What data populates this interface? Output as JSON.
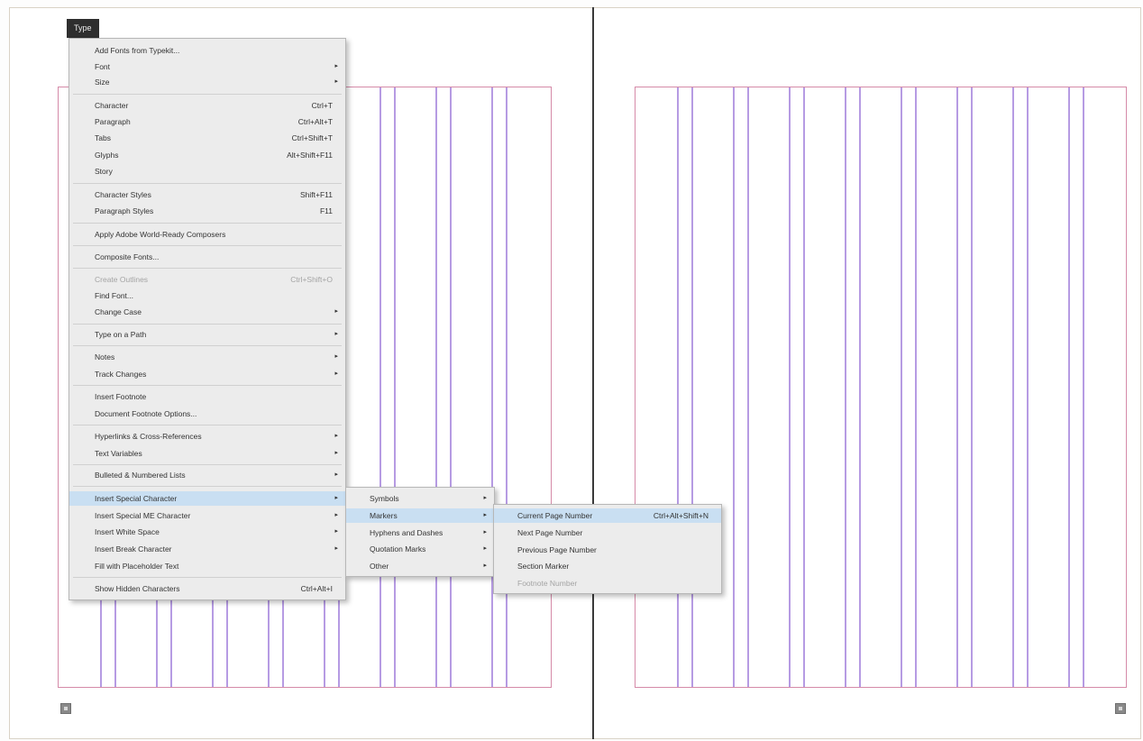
{
  "menu_bar": {
    "tab_label": "Type"
  },
  "type_menu": {
    "items": [
      {
        "label": "Add Fonts from Typekit...",
        "shortcut": "",
        "submenu": false
      },
      {
        "label": "Font",
        "shortcut": "",
        "submenu": true
      },
      {
        "label": "Size",
        "shortcut": "",
        "submenu": true
      },
      {
        "label": "Character",
        "shortcut": "Ctrl+T",
        "submenu": false
      },
      {
        "label": "Paragraph",
        "shortcut": "Ctrl+Alt+T",
        "submenu": false
      },
      {
        "label": "Tabs",
        "shortcut": "Ctrl+Shift+T",
        "submenu": false
      },
      {
        "label": "Glyphs",
        "shortcut": "Alt+Shift+F11",
        "submenu": false
      },
      {
        "label": "Story",
        "shortcut": "",
        "submenu": false
      },
      {
        "label": "Character Styles",
        "shortcut": "Shift+F11",
        "submenu": false
      },
      {
        "label": "Paragraph Styles",
        "shortcut": "F11",
        "submenu": false
      },
      {
        "label": "Apply Adobe World-Ready Composers",
        "shortcut": "",
        "submenu": false
      },
      {
        "label": "Composite Fonts...",
        "shortcut": "",
        "submenu": false
      },
      {
        "label": "Create Outlines",
        "shortcut": "Ctrl+Shift+O",
        "submenu": false,
        "disabled": true
      },
      {
        "label": "Find Font...",
        "shortcut": "",
        "submenu": false
      },
      {
        "label": "Change Case",
        "shortcut": "",
        "submenu": true
      },
      {
        "label": "Type on a Path",
        "shortcut": "",
        "submenu": true
      },
      {
        "label": "Notes",
        "shortcut": "",
        "submenu": true
      },
      {
        "label": "Track Changes",
        "shortcut": "",
        "submenu": true
      },
      {
        "label": "Insert Footnote",
        "shortcut": "",
        "submenu": false
      },
      {
        "label": "Document Footnote Options...",
        "shortcut": "",
        "submenu": false
      },
      {
        "label": "Hyperlinks & Cross-References",
        "shortcut": "",
        "submenu": true
      },
      {
        "label": "Text Variables",
        "shortcut": "",
        "submenu": true
      },
      {
        "label": "Bulleted & Numbered Lists",
        "shortcut": "",
        "submenu": true
      },
      {
        "label": "Insert Special Character",
        "shortcut": "",
        "submenu": true,
        "highlighted": true
      },
      {
        "label": "Insert Special ME Character",
        "shortcut": "",
        "submenu": true
      },
      {
        "label": "Insert White Space",
        "shortcut": "",
        "submenu": true
      },
      {
        "label": "Insert Break Character",
        "shortcut": "",
        "submenu": true
      },
      {
        "label": "Fill with Placeholder Text",
        "shortcut": "",
        "submenu": false
      },
      {
        "label": "Show Hidden Characters",
        "shortcut": "Ctrl+Alt+I",
        "submenu": false
      }
    ]
  },
  "special_char_menu": {
    "items": [
      {
        "label": "Symbols",
        "submenu": true
      },
      {
        "label": "Markers",
        "submenu": true,
        "highlighted": true
      },
      {
        "label": "Hyphens and Dashes",
        "submenu": true
      },
      {
        "label": "Quotation Marks",
        "submenu": true
      },
      {
        "label": "Other",
        "submenu": true
      }
    ]
  },
  "markers_menu": {
    "items": [
      {
        "label": "Current Page Number",
        "shortcut": "Ctrl+Alt+Shift+N",
        "highlighted": true
      },
      {
        "label": "Next Page Number",
        "shortcut": ""
      },
      {
        "label": "Previous Page Number",
        "shortcut": ""
      },
      {
        "label": "Section Marker",
        "shortcut": ""
      },
      {
        "label": "Footnote Number",
        "shortcut": "",
        "disabled": true
      }
    ]
  },
  "icons": {
    "submenu_arrow": "▸",
    "page_icon_left": "page-icon",
    "page_icon_right": "page-icon"
  },
  "colors": {
    "menu_bg": "#ececec",
    "highlight": "#c9dff2",
    "margin_guide": "#d58aa8",
    "column_guide": "#b69be3",
    "spine": "#3a3a3a"
  }
}
